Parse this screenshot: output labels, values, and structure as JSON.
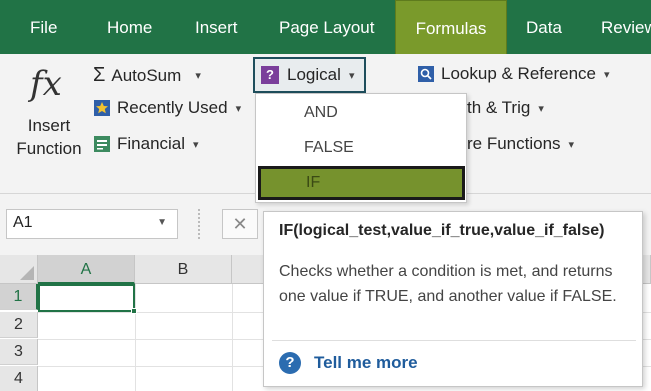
{
  "tabs": [
    {
      "label": "File",
      "active": false
    },
    {
      "label": "Home",
      "active": false
    },
    {
      "label": "Insert",
      "active": false
    },
    {
      "label": "Page Layout",
      "active": false
    },
    {
      "label": "Formulas",
      "active": true
    },
    {
      "label": "Data",
      "active": false
    },
    {
      "label": "Review",
      "active": false
    }
  ],
  "ribbon": {
    "insert_function": {
      "icon": "fx-icon",
      "line1": "Insert",
      "line2": "Function"
    },
    "autosum": "AutoSum",
    "recently_used": "Recently Used",
    "financial": "Financial",
    "logical": "Logical",
    "lookup_reference": "Lookup & Reference",
    "math_trig_partial": "th & Trig",
    "more_functions_partial": "re Functions"
  },
  "logical_menu": {
    "items": [
      "AND",
      "FALSE",
      "IF"
    ],
    "highlighted": "IF"
  },
  "tooltip": {
    "signature": "IF(logical_test,value_if_true,value_if_false)",
    "description": "Checks whether a condition is met, and returns one value if TRUE, and another value if FALSE.",
    "help_link": "Tell me more"
  },
  "formula_bar": {
    "name_box": "A1",
    "cancel_symbol": "✕"
  },
  "grid": {
    "columns": [
      "A",
      "B"
    ],
    "rows": [
      "1",
      "2",
      "3",
      "4"
    ],
    "active_cell": "A1"
  },
  "colors": {
    "tab_bar": "#217346",
    "active_tab": "#7a9a2b",
    "menu_highlight": "#76922d",
    "link": "#1f5c9c"
  }
}
